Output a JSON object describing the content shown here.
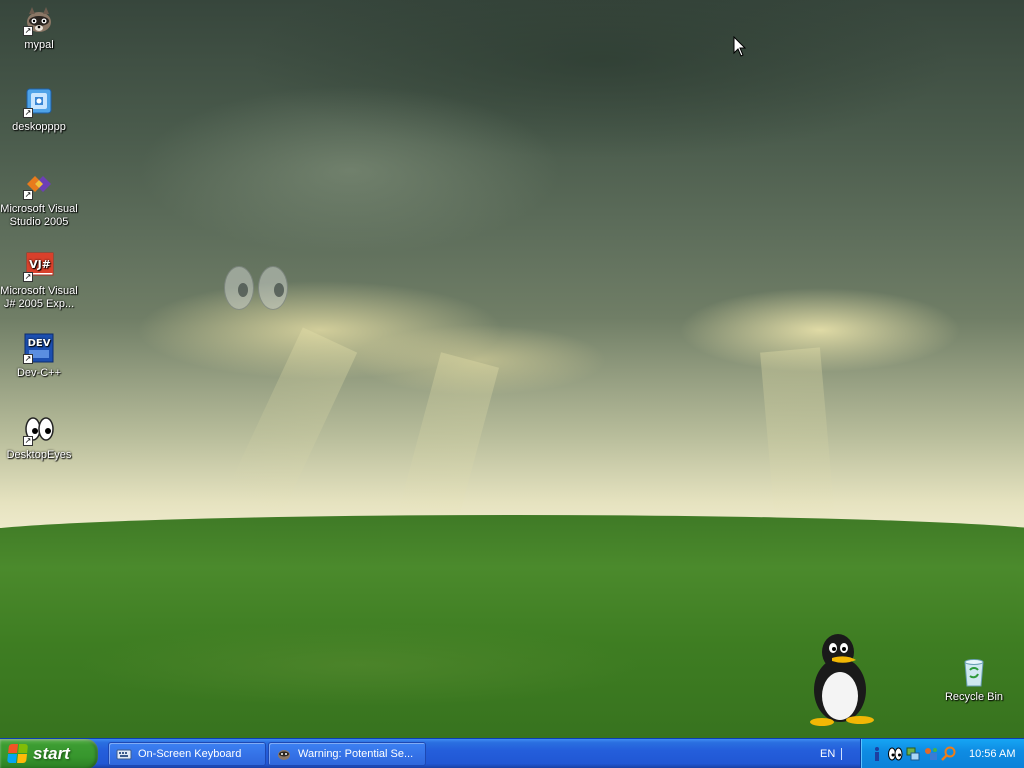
{
  "desktop": {
    "icons": [
      {
        "label": "mypal",
        "icon": "raccoon-icon"
      },
      {
        "label": "deskopppp",
        "icon": "app-window-icon"
      },
      {
        "label": "Microsoft Visual Studio 2005",
        "icon": "visual-studio-icon"
      },
      {
        "label": "Microsoft Visual J# 2005 Exp...",
        "icon": "vjsharp-icon"
      },
      {
        "label": "Dev-C++",
        "icon": "dev-cpp-icon"
      },
      {
        "label": "DesktopEyes",
        "icon": "eyes-icon"
      },
      {
        "label": "Recycle Bin",
        "icon": "recycle-bin-icon"
      }
    ]
  },
  "taskbar": {
    "start_label": "start",
    "tasks": [
      {
        "label": "On-Screen Keyboard",
        "icon": "keyboard-icon"
      },
      {
        "label": "Warning: Potential Se...",
        "icon": "mypal-icon"
      }
    ],
    "language": "EN",
    "tray_icons": [
      "info-icon",
      "eyes-icon",
      "network-icon",
      "tools-icon",
      "search-icon"
    ],
    "clock": "10:56 AM"
  },
  "colors": {
    "taskbar_blue": "#245edb",
    "start_green": "#37962d",
    "tray_blue": "#0e8ce3"
  }
}
